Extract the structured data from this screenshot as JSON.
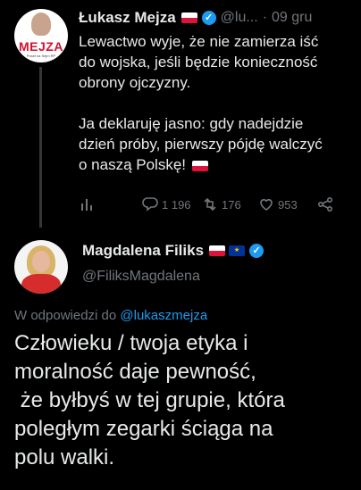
{
  "tweet1": {
    "author_name": "Łukasz Mejza",
    "handle": "@lu...",
    "separator": "·",
    "time": "09 gru",
    "more_label": "⋮",
    "avatar_logo": "MEJZA",
    "avatar_sub": "Poseł na Sejm RP",
    "body": "Lewactwo wyje, że nie zamierza iść\ndo wojska, jeśli będzie konieczność\nobrony ojczyzny.\n\nJa deklaruję jasno: gdy nadejdzie\ndzień próby, pierwszy pójdę walczyć\no naszą Polskę!",
    "actions": {
      "replies": "1 196",
      "retweets": "176",
      "likes": "953"
    }
  },
  "tweet2": {
    "author_name": "Magdalena Filiks",
    "handle": "@FiliksMagdalena",
    "eu_glyph": "★",
    "verified_glyph": "✓",
    "reply_prefix": "W odpowiedzi do ",
    "reply_handle": "@lukaszmejza",
    "body": "Człowieku / twoja etyka i\nmoralność daje pewność,\n że byłbyś w tej grupie, która\npoległym zegarki ściąga na\npolu walki."
  },
  "colors": {
    "background": "#000000",
    "text": "#e7e9ea",
    "muted": "#71767b",
    "accent": "#1d9bf0",
    "thread_line": "#333639"
  }
}
